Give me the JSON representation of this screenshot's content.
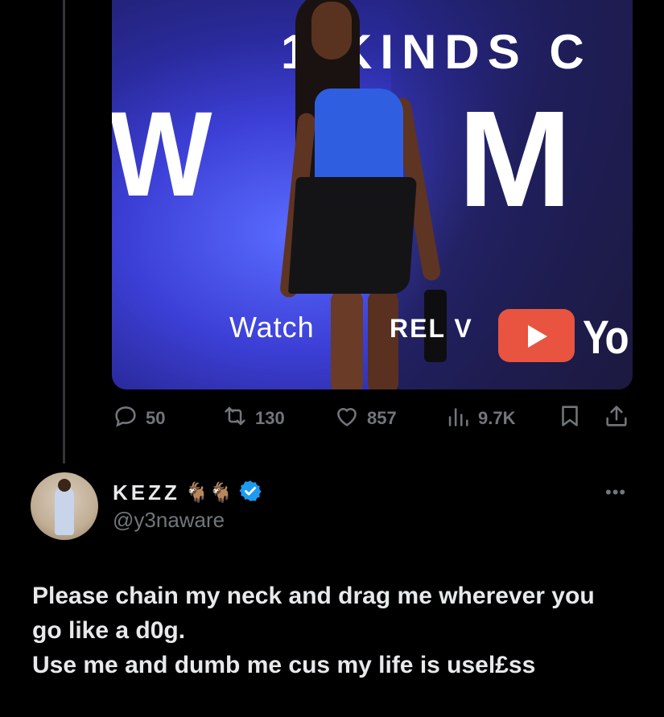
{
  "media": {
    "banner_line1": "1 KINDS C",
    "banner_letter_w": "W",
    "banner_letter_m": "M",
    "banner_watch": "Watch",
    "banner_tv": "REL V",
    "banner_yt": "Yo"
  },
  "actions": {
    "replies": "50",
    "reposts": "130",
    "likes": "857",
    "views": "9.7K"
  },
  "reply_tweet": {
    "display_name": "KEZZ",
    "emojis": "🐐🐐",
    "handle": "@y3naware",
    "more": "•••",
    "text_lines": [
      "Please chain my neck and drag me wherever you",
      "go like a d0g.",
      "Use me and dumb me cus my life is usel£ss"
    ]
  },
  "colors": {
    "background": "#000000",
    "text": "#e7e9ea",
    "muted": "#71767b",
    "verified": "#1d9bf0"
  }
}
